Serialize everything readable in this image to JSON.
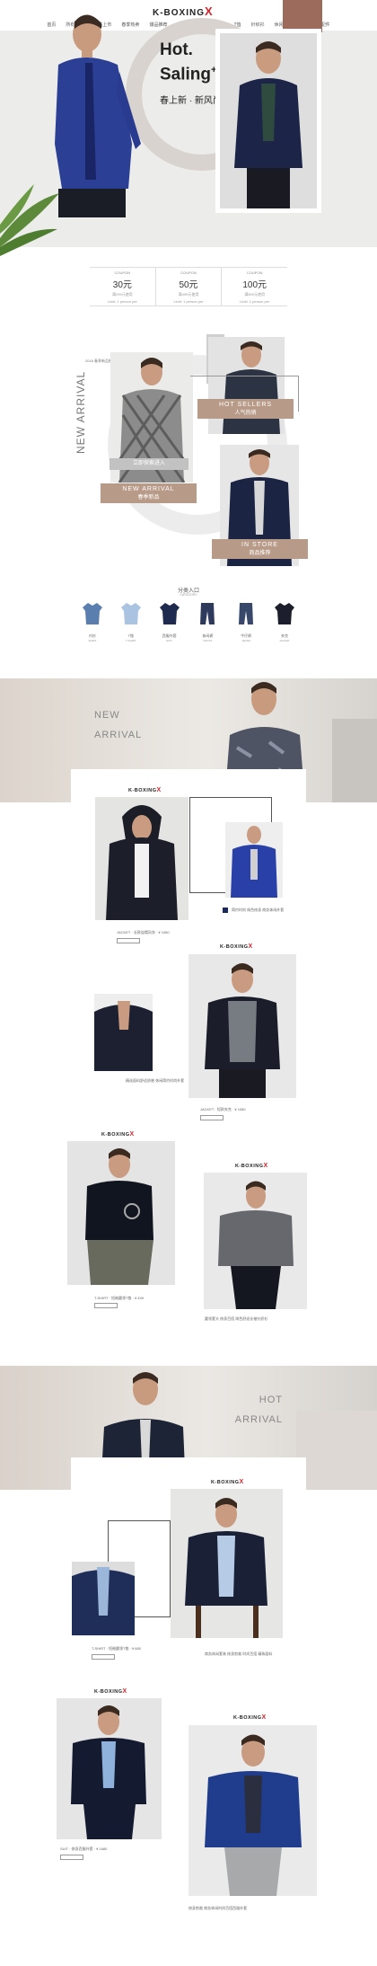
{
  "brand": {
    "name": "K-BOXING",
    "mark": "X"
  },
  "nav": [
    "首页",
    "所有商品",
    "新品上市",
    "春季热卖",
    "爆品推荐",
    "夹克",
    "西装",
    "衬衫",
    "T恤",
    "针织衫",
    "休闲裤",
    "牛仔裤",
    "配件"
  ],
  "nav_hot_index": 6,
  "hero": {
    "title_line1": "Hot.",
    "title_line2": "Saling",
    "title_plus": "+",
    "subtitle": "春上新 · 新风尚"
  },
  "coupons": [
    {
      "top": "COUPON",
      "value": "30元",
      "cond": "满299元使用",
      "cond2": "Limit: 1 person per"
    },
    {
      "top": "COUPON",
      "value": "50元",
      "cond": "满499元使用",
      "cond2": "Limit: 1 person per"
    },
    {
      "top": "COUPON",
      "value": "100元",
      "cond": "满899元使用",
      "cond2": "Limit: 1 person per"
    }
  ],
  "section2": {
    "note": "2018 春季新品推荐",
    "side_text": "NEW ARRIVAL",
    "shop_in": "立即探索进入",
    "hot_sellers": {
      "en": "HOT SELLERS",
      "cn": "人气热销"
    },
    "new_arrival": {
      "en": "NEW ARRIVAL",
      "cn": "春季新品"
    },
    "in_store": {
      "en": "IN STORE",
      "cn": "商品推荐"
    }
  },
  "categories": {
    "title": "分类入口",
    "subtitle": "CATEGORY",
    "items": [
      {
        "cn": "衬衫",
        "en": "SHIRT",
        "icon": "shirt-icon",
        "color": "#5a7fae"
      },
      {
        "cn": "T恤",
        "en": "T-SHIRT",
        "icon": "tshirt-icon",
        "color": "#a9c3e0"
      },
      {
        "cn": "西服外套",
        "en": "SUIT",
        "icon": "suit-icon",
        "color": "#1e2b4e"
      },
      {
        "cn": "休闲裤",
        "en": "PANTS",
        "icon": "pants-icon",
        "color": "#2d3a5c"
      },
      {
        "cn": "牛仔裤",
        "en": "JEANS",
        "icon": "jeans-icon",
        "color": "#37486b"
      },
      {
        "cn": "夹克",
        "en": "JACKET",
        "icon": "jacket-icon",
        "color": "#1c1f2b"
      }
    ]
  },
  "new_arrival": {
    "line1": "NEW",
    "line2": "ARRIVAL",
    "products": [
      {
        "label": "JACKET · 长款连帽风衣 · ¥ 1080",
        "desc": ""
      },
      {
        "label": "",
        "desc": "简约时尚 纯色修身 商务休闲外套"
      },
      {
        "label": "JACKET · 短款夹克 · ¥ 1080",
        "desc": "精选面料舒适质感 休闲简约时尚外套"
      },
      {
        "label": "T-SHIRT · 短袖圆领T恤 · ¥ 499",
        "desc": ""
      },
      {
        "label": "",
        "desc": "圆领套头 修身百搭 纯色舒适长袖针织衫"
      }
    ]
  },
  "hot_arrival": {
    "line1": "HOT",
    "line2": "ARRIVAL",
    "products": [
      {
        "label": "T-SHIRT · 短袖圆领T恤 · ¥ 680",
        "desc": "商务休闲套装 修身剪裁 时尚百搭 精致面料"
      },
      {
        "label": "SUIT · 修身西服外套 · ¥ 1680",
        "desc": ""
      },
      {
        "label": "",
        "desc": "修身剪裁 商务休闲时尚百搭西服外套"
      }
    ]
  },
  "buy_label": "BUY NOW"
}
